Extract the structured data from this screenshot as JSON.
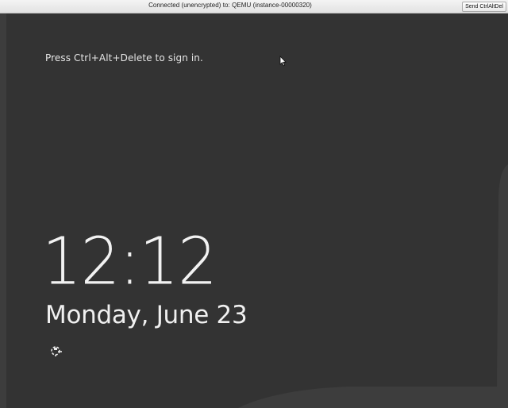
{
  "vnc_bar": {
    "status_text": "Connected (unencrypted) to: QEMU (instance-00000320)",
    "send_ctrl_alt_del_label": "Send CtrlAltDel"
  },
  "lock_screen": {
    "prompt": "Press Ctrl+Alt+Delete to sign in.",
    "time": "12:12",
    "date": "Monday, June 23",
    "network_icon": "network-icon",
    "cursor_icon": "mouse-pointer-icon"
  },
  "colors": {
    "background_dark": "#3c3c3c",
    "background_panel": "#333333",
    "text": "#f2f2f2"
  }
}
